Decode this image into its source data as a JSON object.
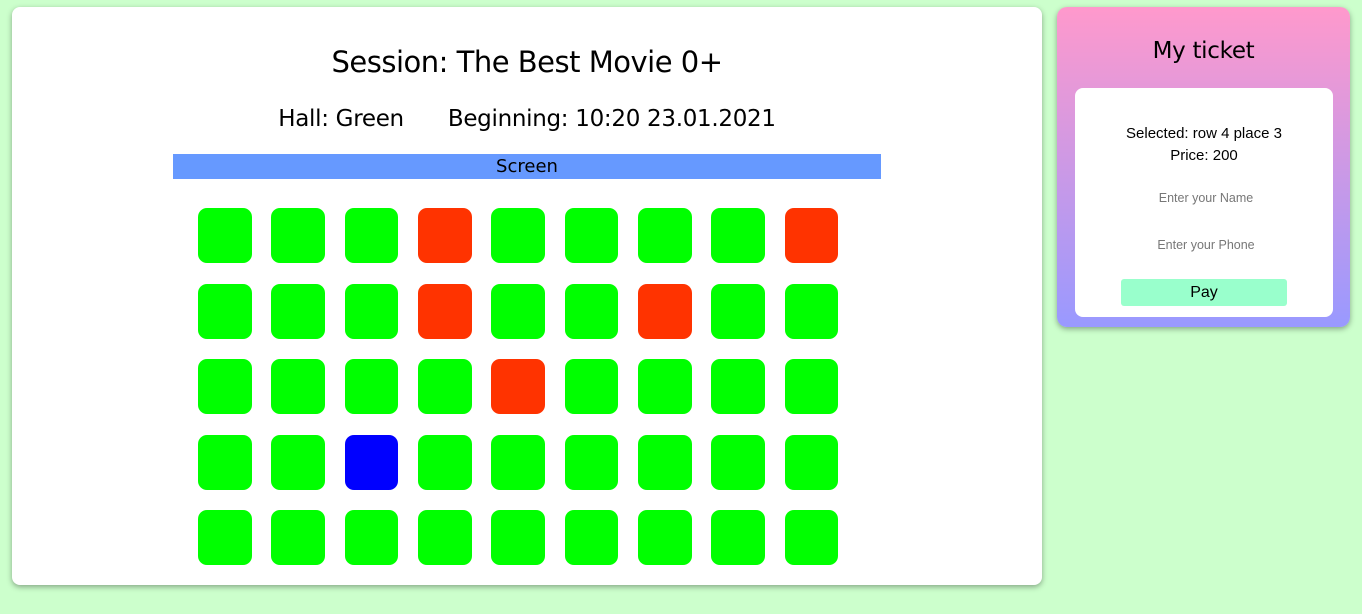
{
  "session": {
    "title": "Session: The Best Movie 0+",
    "hall": "Hall: Green",
    "beginning": "Beginning: 10:20 23.01.2021"
  },
  "screen_label": "Screen",
  "seat_colors": {
    "free": "#00ff00",
    "taken": "#ff3300",
    "selected": "#0000ff"
  },
  "seat_grid": [
    [
      "free",
      "free",
      "free",
      "taken",
      "free",
      "free",
      "free",
      "free",
      "taken"
    ],
    [
      "free",
      "free",
      "free",
      "taken",
      "free",
      "free",
      "taken",
      "free",
      "free"
    ],
    [
      "free",
      "free",
      "free",
      "free",
      "taken",
      "free",
      "free",
      "free",
      "free"
    ],
    [
      "free",
      "free",
      "selected",
      "free",
      "free",
      "free",
      "free",
      "free",
      "free"
    ],
    [
      "free",
      "free",
      "free",
      "free",
      "free",
      "free",
      "free",
      "free",
      "free"
    ]
  ],
  "ticket": {
    "title": "My ticket",
    "selected_line": "Selected: row 4 place 3",
    "price_line": "Price: 200",
    "name_placeholder": "Enter your Name",
    "phone_placeholder": "Enter your Phone",
    "pay_label": "Pay"
  }
}
